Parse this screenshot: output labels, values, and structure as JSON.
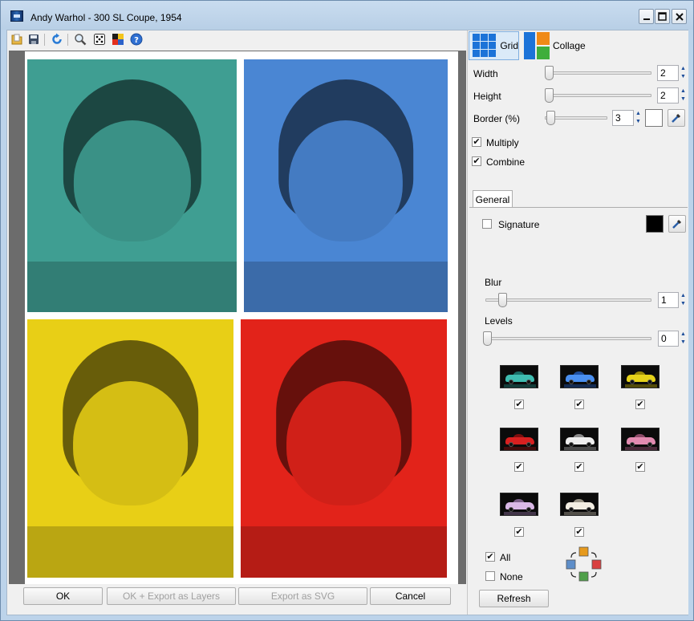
{
  "window": {
    "title": "Andy Warhol - 300 SL Coupe, 1954",
    "min_label": "‒",
    "max_label": "□",
    "close_label": "✕"
  },
  "toolbar": {
    "icons": [
      "open-folder-icon",
      "save-icon",
      "reset-icon",
      "zoom-icon",
      "dice-icon",
      "palette-icon",
      "help-icon"
    ]
  },
  "canvas": {
    "tiles": [
      {
        "name": "photo-tile-teal",
        "tint": "#3f9e92"
      },
      {
        "name": "photo-tile-blue",
        "tint": "#4a86d3"
      },
      {
        "name": "photo-tile-yellow",
        "tint": "#e8cf16"
      },
      {
        "name": "photo-tile-red",
        "tint": "#e2231a"
      }
    ]
  },
  "buttons": {
    "ok": "OK",
    "ok_export_layers": "OK + Export as Layers",
    "export_svg": "Export as SVG",
    "cancel": "Cancel"
  },
  "modes": {
    "grid": "Grid",
    "collage": "Collage"
  },
  "grid_settings": {
    "width_label": "Width",
    "width_value": "2",
    "height_label": "Height",
    "height_value": "2",
    "border_label": "Border (%)",
    "border_value": "3",
    "border_color": "#ffffff",
    "multiply_label": "Multiply",
    "multiply_checked": true,
    "combine_label": "Combine",
    "combine_checked": true
  },
  "tabs": {
    "general": "General"
  },
  "general": {
    "signature_label": "Signature",
    "signature_checked": false,
    "signature_color": "#000000",
    "blur_label": "Blur",
    "blur_value": "1",
    "levels_label": "Levels",
    "levels_value": "0",
    "palette_checks": [
      "✔",
      "✔",
      "✔",
      "✔",
      "✔",
      "✔",
      "✔",
      "✔"
    ],
    "all_label": "All",
    "all_checked": true,
    "none_label": "None",
    "none_checked": false,
    "refresh_label": "Refresh"
  }
}
